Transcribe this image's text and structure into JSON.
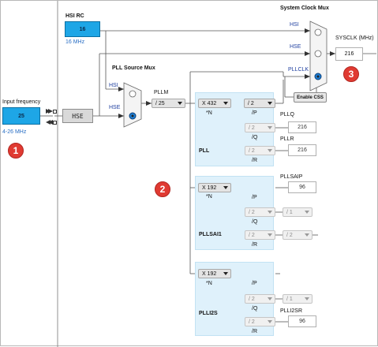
{
  "input": {
    "label": "Input frequency",
    "value": "25",
    "range": "4-26 MHz"
  },
  "hse_block": "HSE",
  "hsi_rc": {
    "label": "HSI RC",
    "value": "16",
    "freq": "16 MHz"
  },
  "pll_source_mux": {
    "title": "PLL Source Mux",
    "hsi": "HSI",
    "hse": "HSE"
  },
  "pllm": {
    "label": "PLLM",
    "value": "/ 25"
  },
  "system_clock_mux": {
    "title": "System Clock Mux",
    "hsi": "HSI",
    "hse": "HSE",
    "pllclk": "PLLCLK"
  },
  "sysclk": {
    "label": "SYSCLK (MHz)",
    "value": "216"
  },
  "enable_css": "Enable CSS",
  "pll": {
    "name": "PLL",
    "n": "X 432",
    "n_label": "*N",
    "p": "/ 2",
    "p_label": "/P",
    "q": "/ 2",
    "q_label": "/Q",
    "r": "/ 2",
    "r_label": "/R",
    "pllq_label": "PLLQ",
    "pllq_value": "216",
    "pllr_label": "PLLR",
    "pllr_value": "216"
  },
  "pllsai1": {
    "name": "PLLSAI1",
    "n": "X 192",
    "n_label": "*N",
    "p_label": "/P",
    "q": "/ 2",
    "q_label": "/Q",
    "r": "/ 2",
    "r_label": "/R",
    "q_div": "/ 1",
    "r_div": "/ 2",
    "pllsaip_label": "PLLSAIP",
    "pllsaip_value": "96"
  },
  "plli2s": {
    "name": "PLLI2S",
    "n": "X 192",
    "n_label": "*N",
    "p_label": "/P",
    "q": "/ 2",
    "q_label": "/Q",
    "r": "/ 2",
    "r_label": "/R",
    "q_div": "/ 1",
    "plli2sr_label": "PLLI2SR",
    "plli2sr_value": "96"
  },
  "badges": [
    "1",
    "2",
    "3"
  ],
  "colors": {
    "input_box": "#1ea6e6",
    "panel": "#dff1fb",
    "badge": "#e03a32",
    "label_blue": "#1f3fa0"
  }
}
